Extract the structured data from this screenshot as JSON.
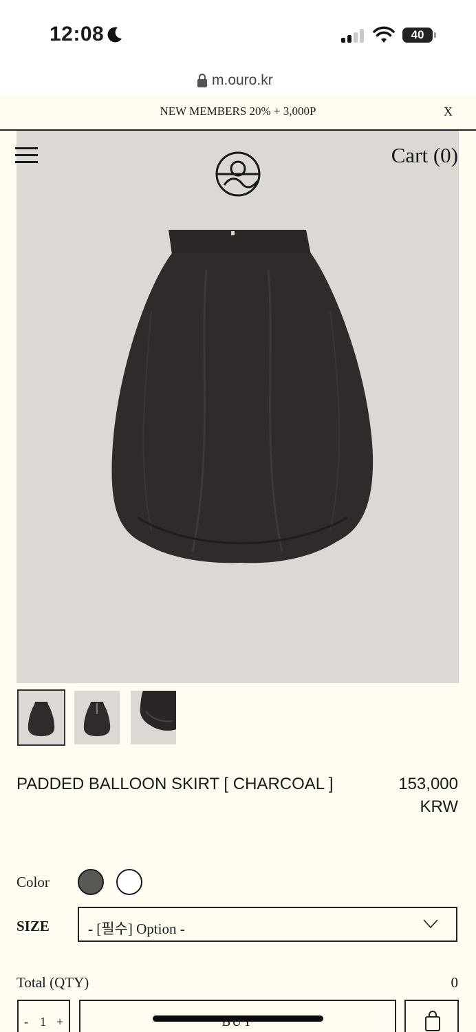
{
  "status_bar": {
    "time": "12:08",
    "battery": "40"
  },
  "browser": {
    "url": "m.ouro.kr"
  },
  "promo": {
    "text": "NEW MEMBERS 20% + 3,000P",
    "close": "X"
  },
  "header": {
    "cart_label": "Cart (0)"
  },
  "product": {
    "name": "PADDED BALLOON SKIRT [ CHARCOAL ]",
    "price_line1": "153,000",
    "price_line2": "KRW"
  },
  "options": {
    "color_label": "Color",
    "colors": [
      "#5a5855",
      "#ffffff"
    ],
    "size_label": "SIZE",
    "size_placeholder": "- [필수] Option -"
  },
  "total": {
    "label": "Total (QTY)",
    "value": "0"
  },
  "purchase": {
    "qty_minus": "-",
    "qty_value": "1",
    "qty_plus": "+",
    "buy_label": "BUY"
  },
  "colors": {
    "background": "#fefcf0",
    "hero_bg": "#dcd8d3",
    "skirt": "#2c2828"
  }
}
